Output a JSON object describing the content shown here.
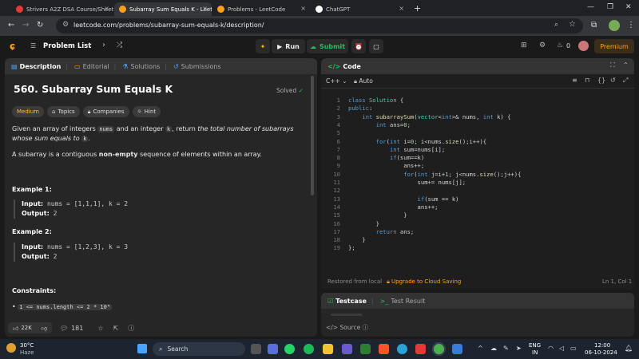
{
  "browser": {
    "tabs": [
      {
        "label": "Strivers A2Z DSA Course/Sheet",
        "active": false,
        "color": "#e53935"
      },
      {
        "label": "Subarray Sum Equals K - LeetCo",
        "active": true,
        "color": "#f89f1b"
      },
      {
        "label": "Problems - LeetCode",
        "active": false,
        "color": "#f89f1b"
      },
      {
        "label": "ChatGPT",
        "active": false,
        "color": "#ffffff"
      }
    ],
    "url": "leetcode.com/problems/subarray-sum-equals-k/description/"
  },
  "header": {
    "problem_list": "Problem List",
    "run": "Run",
    "submit": "Submit",
    "fire_count": "0",
    "premium": "Premium"
  },
  "left_panel": {
    "tabs": [
      "Description",
      "Editorial",
      "Solutions",
      "Submissions"
    ],
    "title": "560. Subarray Sum Equals K",
    "solved": "Solved",
    "tags": [
      "Medium",
      "Topics",
      "Companies",
      "Hint"
    ],
    "desc_1": "Given an array of integers",
    "desc_nums": "nums",
    "desc_2": "and an integer",
    "desc_k": "k",
    "desc_3": ", return",
    "desc_italic": "the total number of subarrays whose sum equals to",
    "desc_k2": "k",
    "desc_4": ".",
    "sub_1": "A subarray is a contiguous",
    "sub_bold": "non-empty",
    "sub_2": "sequence of elements within an array.",
    "example1_title": "Example 1:",
    "example1_input_label": "Input:",
    "example1_input": "nums = [1,1,1], k = 2",
    "example1_output_label": "Output:",
    "example1_output": "2",
    "example2_title": "Example 2:",
    "example2_input_label": "Input:",
    "example2_input": "nums = [1,2,3], k = 3",
    "example2_output_label": "Output:",
    "example2_output": "2",
    "constraints_title": "Constraints:",
    "constraint_1": "1 <= nums.length <= 2 * 10⁴",
    "likes": "22K",
    "comments": "181"
  },
  "editor": {
    "title": "Code",
    "language": "C++",
    "mode": "Auto",
    "lines": [
      "class Solution {",
      "public:",
      "    int subarraySum(vector<int>& nums, int k) {",
      "        int ans=0;",
      "",
      "        for(int i=0; i<nums.size();i++){",
      "            int sum=nums[i];",
      "            if(sum==k)",
      "                ans++;",
      "                for(int j=i+1; j<nums.size();j++){",
      "                    sum+= nums[j];",
      "",
      "                    if(sum == k)",
      "                    ans++;",
      "                }",
      "        }",
      "        return ans;",
      "    }",
      "};"
    ],
    "restored": "Restored from local",
    "upgrade": "Upgrade to Cloud Saving",
    "cursor": "Ln 1, Col 1"
  },
  "bottom_panel": {
    "testcase": "Testcase",
    "test_result": "Test Result",
    "source": "Source"
  },
  "taskbar": {
    "temp": "30°C",
    "weather": "Haze",
    "search": "Search",
    "lang": "ENG",
    "region": "IN",
    "time": "12:00",
    "date": "06-10-2024"
  }
}
